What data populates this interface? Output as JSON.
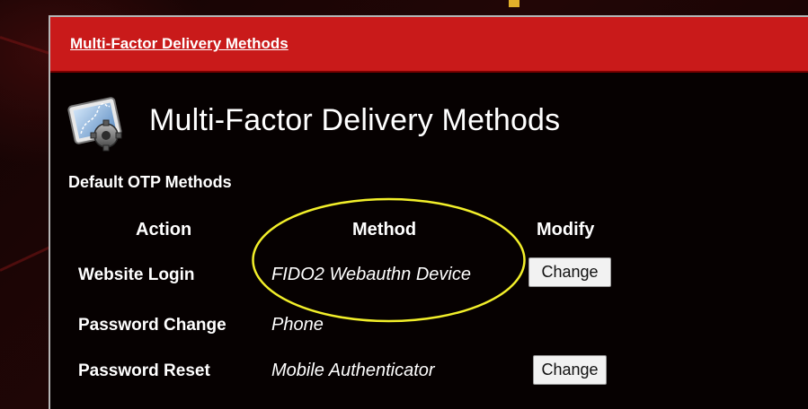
{
  "colors": {
    "header_red": "#c91a1a",
    "panel_bg": "#060101",
    "highlight": "#f2ef2a",
    "accent": "#e2b02a"
  },
  "panel": {
    "header_title": "Multi-Factor Delivery Methods",
    "icon": "settings-gear-icon",
    "page_title": "Multi-Factor Delivery Methods",
    "section_title": "Default OTP Methods"
  },
  "table": {
    "headers": [
      "Action",
      "Method",
      "Modify"
    ],
    "rows": [
      {
        "action": "Website Login",
        "method": "FIDO2 Webauthn Device",
        "button": "Change"
      },
      {
        "action": "Password Change",
        "method": "Phone",
        "button": ""
      },
      {
        "action": "Password Reset",
        "method": "Mobile Authenticator",
        "button": "Change"
      }
    ]
  }
}
